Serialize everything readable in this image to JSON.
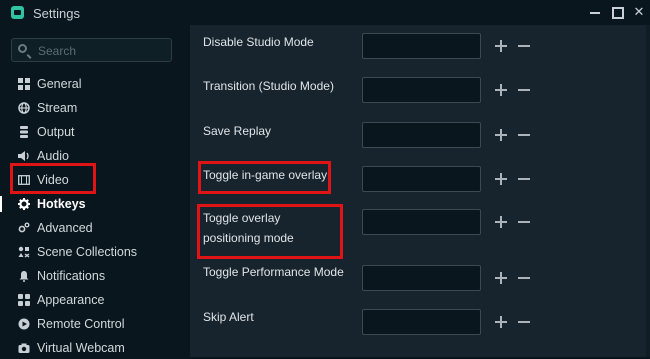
{
  "window": {
    "title": "Settings",
    "icons": {
      "app": "streamlabs-icon",
      "minimize": "minimize-icon",
      "maximize": "maximize-icon",
      "close": "close-icon"
    }
  },
  "sidebar": {
    "search_placeholder": "Search",
    "items": [
      {
        "label": "General",
        "icon": "grid-icon"
      },
      {
        "label": "Stream",
        "icon": "globe-icon"
      },
      {
        "label": "Output",
        "icon": "database-icon"
      },
      {
        "label": "Audio",
        "icon": "speaker-icon"
      },
      {
        "label": "Video",
        "icon": "film-icon"
      },
      {
        "label": "Hotkeys",
        "icon": "gear-icon",
        "active": true
      },
      {
        "label": "Advanced",
        "icon": "gears-icon"
      },
      {
        "label": "Scene Collections",
        "icon": "collections-icon"
      },
      {
        "label": "Notifications",
        "icon": "bell-icon"
      },
      {
        "label": "Appearance",
        "icon": "palette-icon"
      },
      {
        "label": "Remote Control",
        "icon": "play-circle-icon"
      },
      {
        "label": "Virtual Webcam",
        "icon": "camera-icon"
      }
    ]
  },
  "hotkeys": [
    {
      "label": "Disable Studio Mode",
      "value": ""
    },
    {
      "label": "Transition (Studio Mode)",
      "value": ""
    },
    {
      "label": "Save Replay",
      "value": ""
    },
    {
      "label": "Toggle in-game overlay",
      "value": "",
      "highlighted": true
    },
    {
      "label": "Toggle overlay positioning mode",
      "value": "",
      "highlighted": true
    },
    {
      "label": "Toggle Performance Mode",
      "value": ""
    },
    {
      "label": "Skip Alert",
      "value": ""
    }
  ],
  "colors": {
    "highlight": "#e01414",
    "sidebar_bg": "#09161d",
    "panel_bg": "#17242d"
  }
}
